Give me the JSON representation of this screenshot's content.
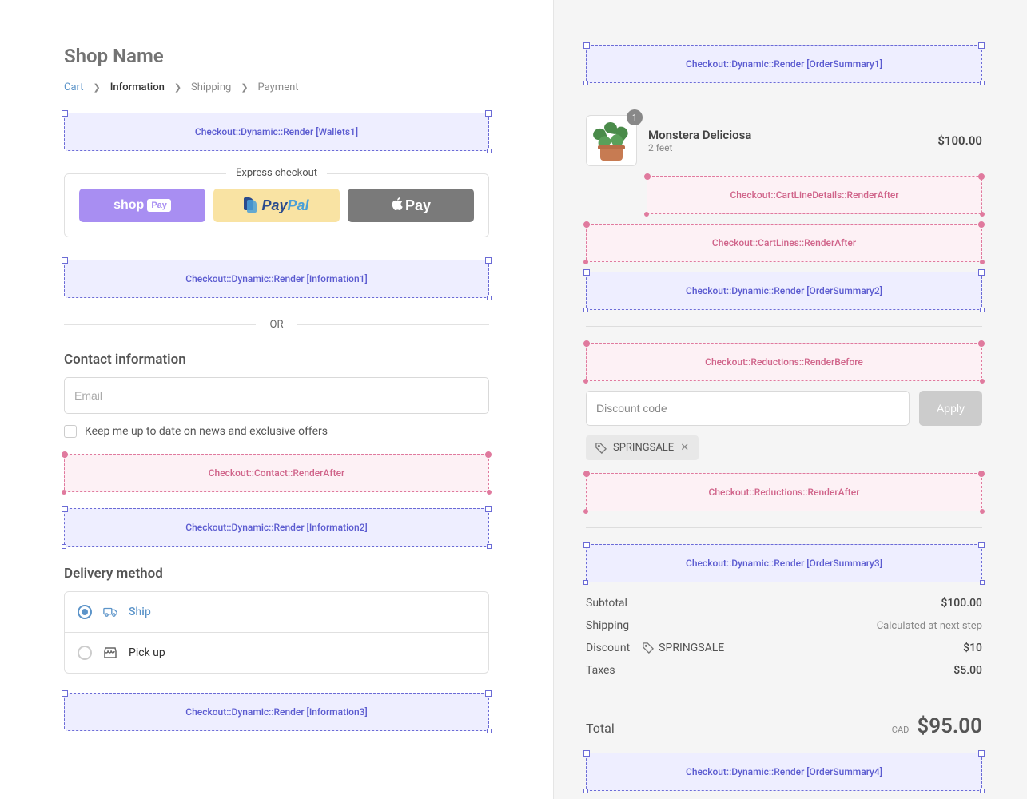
{
  "shop": {
    "name": "Shop Name"
  },
  "breadcrumb": {
    "cart": "Cart",
    "information": "Information",
    "shipping": "Shipping",
    "payment": "Payment"
  },
  "slots": {
    "wallets1": "Checkout::Dynamic::Render [Wallets1]",
    "information1": "Checkout::Dynamic::Render [Information1]",
    "contactAfter": "Checkout::Contact::RenderAfter",
    "information2": "Checkout::Dynamic::Render [Information2]",
    "information3": "Checkout::Dynamic::Render [Information3]",
    "orderSummary1": "Checkout::Dynamic::Render [OrderSummary1]",
    "cartLineDetailsAfter": "Checkout::CartLineDetails::RenderAfter",
    "cartLinesAfter": "Checkout::CartLines::RenderAfter",
    "orderSummary2": "Checkout::Dynamic::Render [OrderSummary2]",
    "reductionsBefore": "Checkout::Reductions::RenderBefore",
    "reductionsAfter": "Checkout::Reductions::RenderAfter",
    "orderSummary3": "Checkout::Dynamic::Render [OrderSummary3]",
    "orderSummary4": "Checkout::Dynamic::Render [OrderSummary4]"
  },
  "express": {
    "label": "Express checkout",
    "shopPay": {
      "shop": "shop",
      "pay": "Pay"
    },
    "paypal": {
      "pay": "Pay",
      "pal": "Pal"
    },
    "applePay": "Pay"
  },
  "divider": {
    "or": "OR"
  },
  "contact": {
    "title": "Contact information",
    "emailPlaceholder": "Email",
    "newsletter": "Keep me up to date on news and exclusive offers"
  },
  "delivery": {
    "title": "Delivery method",
    "ship": "Ship",
    "pickup": "Pick up"
  },
  "cart": {
    "item": {
      "qty": "1",
      "name": "Monstera Deliciosa",
      "variant": "2 feet",
      "price": "$100.00"
    }
  },
  "discount": {
    "placeholder": "Discount code",
    "apply": "Apply",
    "applied": "SPRINGSALE"
  },
  "summary": {
    "subtotalLabel": "Subtotal",
    "subtotal": "$100.00",
    "shippingLabel": "Shipping",
    "shipping": "Calculated at next step",
    "discountLabel": "Discount",
    "discountCode": "SPRINGSALE",
    "discount": "$10",
    "taxesLabel": "Taxes",
    "taxes": "$5.00",
    "totalLabel": "Total",
    "currency": "CAD",
    "total": "$95.00"
  }
}
